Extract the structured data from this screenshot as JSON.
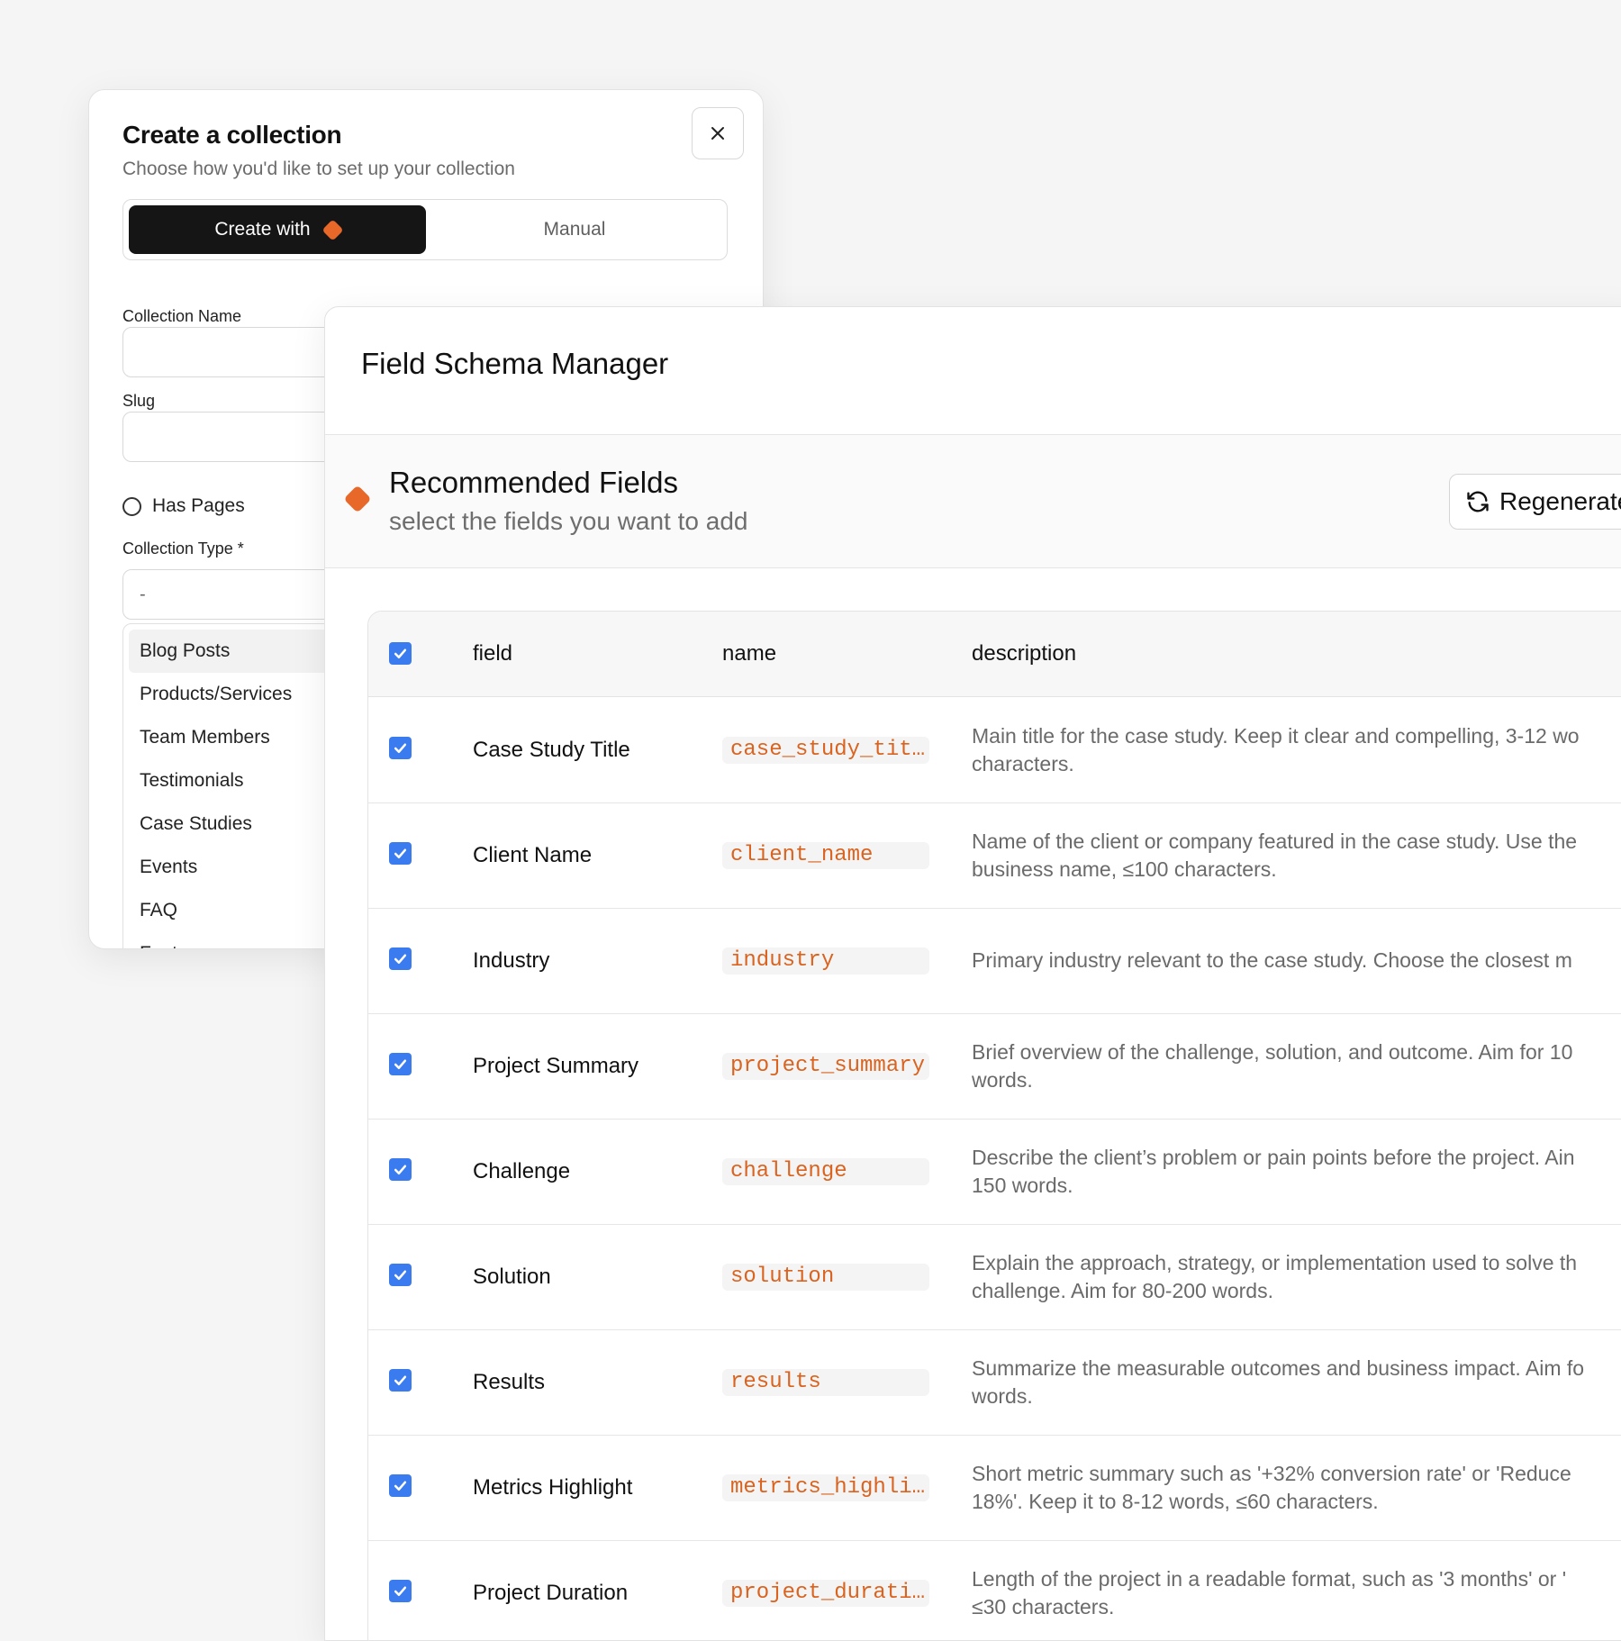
{
  "collection_dialog": {
    "title": "Create a collection",
    "subtitle": "Choose how you'd like to set up your collection",
    "tabs": {
      "create_with": "Create with",
      "manual": "Manual"
    },
    "collection_name_label": "Collection Name",
    "slug_label": "Slug",
    "has_pages_label": "Has Pages",
    "collection_type_label": "Collection Type *",
    "collection_type_value": "-",
    "collection_type_options": [
      "Blog Posts",
      "Products/Services",
      "Team Members",
      "Testimonials",
      "Case Studies",
      "Events",
      "FAQ",
      "Features"
    ]
  },
  "schema_manager": {
    "title": "Field Schema Manager",
    "recommended_title": "Recommended Fields",
    "recommended_subtitle": "select the fields you want to add",
    "regenerate_label": "Regenerate",
    "columns": {
      "field": "field",
      "name": "name",
      "description": "description"
    },
    "rows": [
      {
        "field": "Case Study Title",
        "name": "case_study_tit…",
        "desc1": "Main title for the case study. Keep it clear and compelling, 3-12 wo",
        "desc2": "characters."
      },
      {
        "field": "Client Name",
        "name": "client_name",
        "desc1": "Name of the client or company featured in the case study. Use the",
        "desc2": "business name, ≤100 characters."
      },
      {
        "field": "Industry",
        "name": "industry",
        "desc1": "Primary industry relevant to the case study. Choose the closest m",
        "desc2": ""
      },
      {
        "field": "Project Summary",
        "name": "project_summary",
        "desc1": "Brief overview of the challenge, solution, and outcome. Aim for 10",
        "desc2": "words."
      },
      {
        "field": "Challenge",
        "name": "challenge",
        "desc1": "Describe the client’s problem or pain points before the project. Ain",
        "desc2": "150 words."
      },
      {
        "field": "Solution",
        "name": "solution",
        "desc1": "Explain the approach, strategy, or implementation used to solve th",
        "desc2": "challenge. Aim for 80-200 words."
      },
      {
        "field": "Results",
        "name": "results",
        "desc1": "Summarize the measurable outcomes and business impact. Aim fo",
        "desc2": "words."
      },
      {
        "field": "Metrics Highlight",
        "name": "metrics_highli…",
        "desc1": "Short metric summary such as '+32% conversion rate' or 'Reduce",
        "desc2": "18%'. Keep it to 8-12 words, ≤60 characters."
      },
      {
        "field": "Project Duration",
        "name": "project_durati…",
        "desc1": "Length of the project in a readable format, such as '3 months' or '",
        "desc2": "≤30 characters."
      }
    ]
  },
  "colors": {
    "accent": "#e8682a",
    "checkbox": "#3b7bf0",
    "code_text": "#d9631f"
  },
  "icons": [
    "close-icon",
    "sparkle-diamond-icon",
    "regenerate-icon",
    "checkbox-checked-icon"
  ]
}
